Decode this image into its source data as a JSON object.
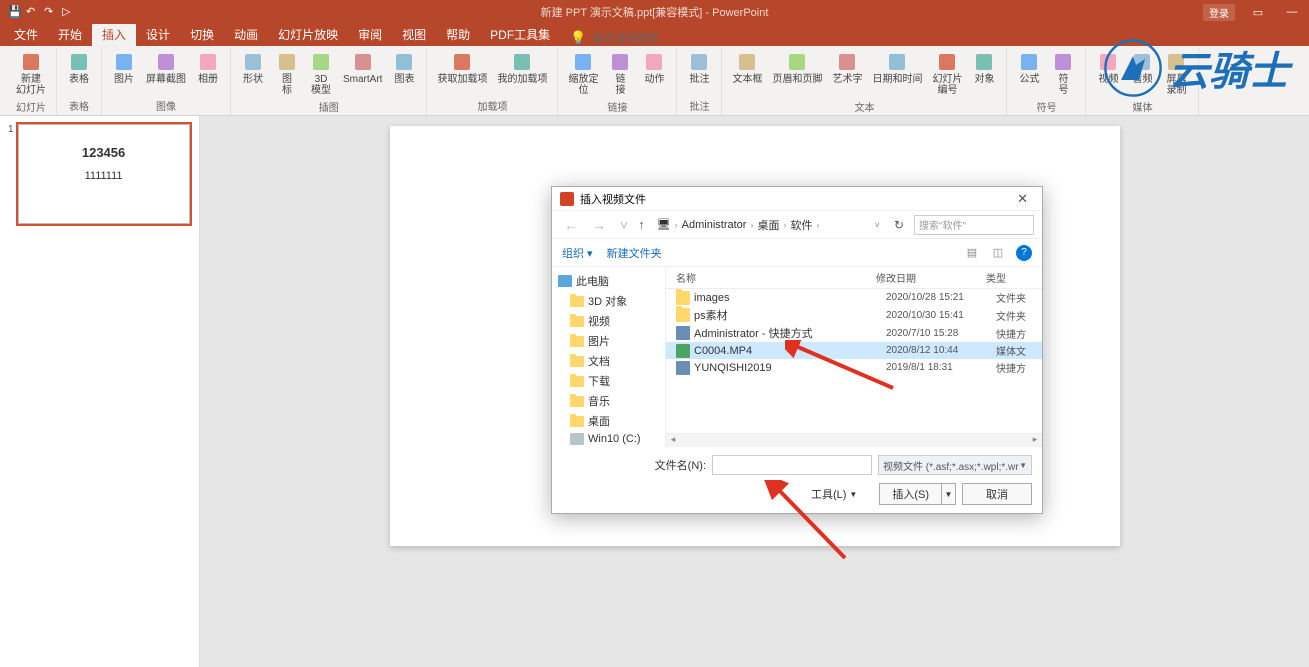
{
  "titlebar": {
    "title": "新建 PPT 演示文稿.ppt[兼容模式] - PowerPoint",
    "login": "登录"
  },
  "tabs": [
    "文件",
    "开始",
    "插入",
    "设计",
    "切换",
    "动画",
    "幻灯片放映",
    "审阅",
    "视图",
    "帮助",
    "PDF工具集"
  ],
  "active_tab": "插入",
  "search_prompt": "操作说明搜索",
  "ribbon": {
    "groups": [
      {
        "name": "幻灯片",
        "items": [
          {
            "label": "新建\n幻灯片"
          }
        ]
      },
      {
        "name": "表格",
        "items": [
          {
            "label": "表格"
          }
        ]
      },
      {
        "name": "图像",
        "items": [
          {
            "label": "图片"
          },
          {
            "label": "屏幕截图"
          },
          {
            "label": "相册"
          }
        ]
      },
      {
        "name": "插图",
        "items": [
          {
            "label": "形状"
          },
          {
            "label": "图\n标"
          },
          {
            "label": "3D\n模型"
          },
          {
            "label": "SmartArt"
          },
          {
            "label": "图表"
          }
        ]
      },
      {
        "name": "加载项",
        "items": [
          {
            "label": "获取加载项",
            "side": true
          },
          {
            "label": "我的加载项"
          }
        ]
      },
      {
        "name": "链接",
        "items": [
          {
            "label": "缩放定\n位"
          },
          {
            "label": "链\n接"
          },
          {
            "label": "动作"
          }
        ]
      },
      {
        "name": "批注",
        "items": [
          {
            "label": "批注"
          }
        ]
      },
      {
        "name": "文本",
        "items": [
          {
            "label": "文本框"
          },
          {
            "label": "页眉和页脚"
          },
          {
            "label": "艺术字"
          },
          {
            "label": "日期和时间"
          },
          {
            "label": "幻灯片\n编号"
          },
          {
            "label": "对象"
          }
        ]
      },
      {
        "name": "符号",
        "items": [
          {
            "label": "公式"
          },
          {
            "label": "符\n号"
          }
        ]
      },
      {
        "name": "媒体",
        "items": [
          {
            "label": "视频"
          },
          {
            "label": "音频"
          },
          {
            "label": "屏幕\n录制"
          }
        ]
      }
    ]
  },
  "thumbnail": {
    "num": "1",
    "t1": "123456",
    "t2": "1111111"
  },
  "dialog": {
    "title": "插入视频文件",
    "breadcrumb": [
      "Administrator",
      "桌面",
      "软件"
    ],
    "search_placeholder": "搜索\"软件\"",
    "toolbar": {
      "organize": "组织",
      "newfolder": "新建文件夹"
    },
    "tree": [
      {
        "label": "此电脑",
        "icon": "pc",
        "sub": false
      },
      {
        "label": "3D 对象",
        "icon": "folder",
        "sub": true
      },
      {
        "label": "视频",
        "icon": "folder",
        "sub": true
      },
      {
        "label": "图片",
        "icon": "folder",
        "sub": true
      },
      {
        "label": "文档",
        "icon": "folder",
        "sub": true
      },
      {
        "label": "下载",
        "icon": "folder",
        "sub": true
      },
      {
        "label": "音乐",
        "icon": "folder",
        "sub": true
      },
      {
        "label": "桌面",
        "icon": "folder",
        "sub": true
      },
      {
        "label": "Win10 (C:)",
        "icon": "drive",
        "sub": true
      }
    ],
    "columns": {
      "name": "名称",
      "date": "修改日期",
      "type": "类型"
    },
    "rows": [
      {
        "name": "images",
        "date": "2020/10/28 15:21",
        "type": "文件夹",
        "icon": "folder"
      },
      {
        "name": "ps素材",
        "date": "2020/10/30 15:41",
        "type": "文件夹",
        "icon": "folder"
      },
      {
        "name": "Administrator - 快捷方式",
        "date": "2020/7/10 15:28",
        "type": "快捷方",
        "icon": "link"
      },
      {
        "name": "C0004.MP4",
        "date": "2020/8/12 10:44",
        "type": "媒体文",
        "icon": "video",
        "selected": true
      },
      {
        "name": "YUNQISHI2019",
        "date": "2019/8/1 18:31",
        "type": "快捷方",
        "icon": "link"
      }
    ],
    "footer": {
      "filename_label": "文件名(N):",
      "filetype": "视频文件 (*.asf;*.asx;*.wpl;*.wr",
      "tools": "工具(L)",
      "insert": "插入(S)",
      "cancel": "取消"
    }
  },
  "watermark_text": "云骑士"
}
